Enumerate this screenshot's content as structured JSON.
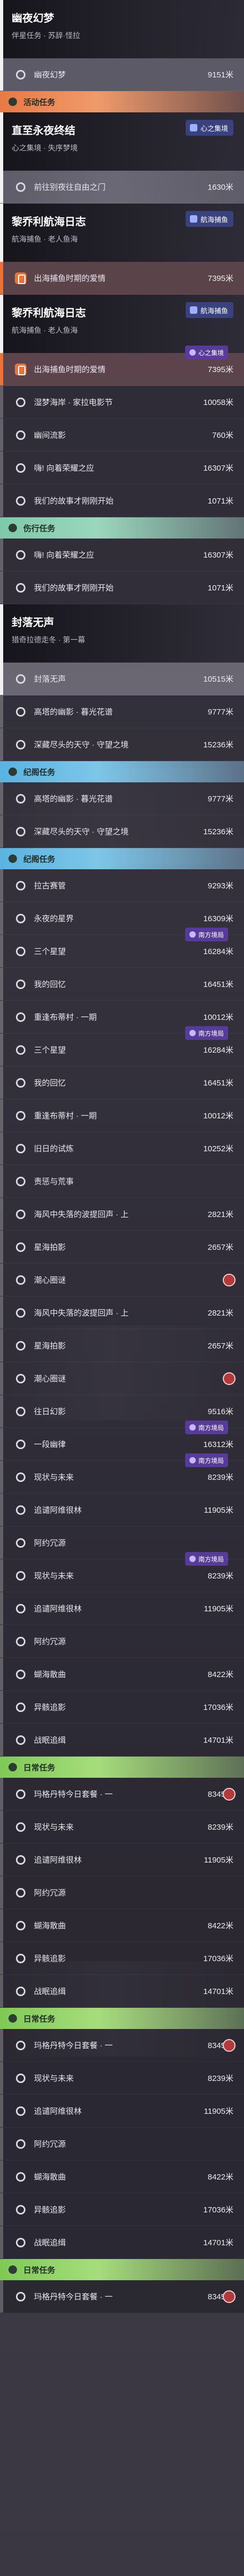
{
  "sections": [
    {
      "kind": "header",
      "title": "幽夜幻梦",
      "sub": "伴星任务 · 苏辞·怪拉",
      "badge": ""
    },
    {
      "kind": "item",
      "state": "sel",
      "name": "幽夜幻梦",
      "dist": "9151米"
    },
    {
      "kind": "sec",
      "color": "orange",
      "title": "活动任务"
    },
    {
      "kind": "header",
      "title": "直至永夜终结",
      "sub": "心之集境 · 失序梦境",
      "badge": "心之集境"
    },
    {
      "kind": "item",
      "state": "sel",
      "name": "前往别夜往自由之门",
      "dist": "1630米"
    },
    {
      "kind": "header",
      "title": "黎乔利航海日志",
      "sub": "航海捕鱼 · 老人鱼海",
      "badge": "航海捕鱼"
    },
    {
      "kind": "item",
      "state": "locked",
      "name": "出海捕鱼时期的爱情",
      "dist": "7395米"
    },
    {
      "kind": "header",
      "title": "黎乔利航海日志",
      "sub": "航海捕鱼 · 老人鱼海",
      "badge": "航海捕鱼"
    },
    {
      "kind": "item",
      "state": "locked",
      "name": "出海捕鱼时期的爱情",
      "dist": "7395米",
      "sidebadge": "心之集境"
    },
    {
      "kind": "item",
      "state": "",
      "name": "湿梦海岸 · 家拉电影节",
      "dist": "10058米"
    },
    {
      "kind": "item",
      "state": "",
      "name": "幽间流影",
      "dist": "760米"
    },
    {
      "kind": "item",
      "state": "",
      "name": "嗨! 向着荣耀之应",
      "dist": "16307米"
    },
    {
      "kind": "item",
      "state": "",
      "name": "我们的故事才刚刚开始",
      "dist": "1071米"
    },
    {
      "kind": "sec",
      "color": "teal",
      "title": "伤行任务"
    },
    {
      "kind": "item",
      "state": "",
      "name": "嗨! 向着荣耀之应",
      "dist": "16307米"
    },
    {
      "kind": "item",
      "state": "",
      "name": "我们的故事才刚刚开始",
      "dist": "1071米"
    },
    {
      "kind": "header",
      "title": "封落无声",
      "sub": "猎奇拉德走冬 · 第一幕",
      "badge": ""
    },
    {
      "kind": "item",
      "state": "sel",
      "name": "封落无声",
      "dist": "10515米"
    },
    {
      "kind": "item",
      "state": "",
      "name": "高塔的幽影 · 暮光花谱",
      "dist": "9777米"
    },
    {
      "kind": "item",
      "state": "",
      "name": "深藏尽头的天守 · 守望之境",
      "dist": "15236米"
    },
    {
      "kind": "sec",
      "color": "blue",
      "title": "纪阁任务"
    },
    {
      "kind": "item",
      "state": "",
      "name": "高塔的幽影 · 暮光花谱",
      "dist": "9777米"
    },
    {
      "kind": "item",
      "state": "",
      "name": "深藏尽头的天守 · 守望之境",
      "dist": "15236米"
    },
    {
      "kind": "sec",
      "color": "blue",
      "title": "纪阁任务"
    },
    {
      "kind": "item",
      "state": "",
      "name": "拉古赛管",
      "dist": "9293米"
    },
    {
      "kind": "item",
      "state": "",
      "name": "永夜的星界",
      "dist": "16309米"
    },
    {
      "kind": "item",
      "state": "",
      "name": "三个星望",
      "dist": "16284米",
      "sidebadge": "南方境局"
    },
    {
      "kind": "item",
      "state": "",
      "name": "我的回忆",
      "dist": "16451米"
    },
    {
      "kind": "item",
      "state": "",
      "name": "重逢布蒂村 · 一期",
      "dist": "10012米"
    },
    {
      "kind": "item",
      "state": "",
      "name": "三个星望",
      "dist": "16284米",
      "sidebadge": "南方境局"
    },
    {
      "kind": "item",
      "state": "",
      "name": "我的回忆",
      "dist": "16451米"
    },
    {
      "kind": "item",
      "state": "",
      "name": "重逢布蒂村 · 一期",
      "dist": "10012米"
    },
    {
      "kind": "item",
      "state": "",
      "name": "旧日的试炼",
      "dist": "10252米"
    },
    {
      "kind": "item",
      "state": "",
      "name": "责惩与荒事",
      "dist": ""
    },
    {
      "kind": "item",
      "state": "",
      "name": "海风中失落的波提回声 · 上",
      "dist": "2821米"
    },
    {
      "kind": "item",
      "state": "",
      "name": "星海拍影",
      "dist": "2657米"
    },
    {
      "kind": "item",
      "state": "",
      "name": "潮心圈谜",
      "dist": "",
      "marker": true
    },
    {
      "kind": "item",
      "state": "",
      "name": "海风中失落的波提回声 · 上",
      "dist": "2821米"
    },
    {
      "kind": "item",
      "state": "",
      "name": "星海拍影",
      "dist": "2657米"
    },
    {
      "kind": "item",
      "state": "",
      "name": "潮心圈谜",
      "dist": "",
      "marker": true
    },
    {
      "kind": "item",
      "state": "",
      "name": "往日幻影",
      "dist": "9516米"
    },
    {
      "kind": "item",
      "state": "",
      "name": "一段幽律",
      "dist": "16312米",
      "sidebadge": "南方境局"
    },
    {
      "kind": "item",
      "state": "",
      "name": "现状与未来",
      "dist": "8239米",
      "sidebadge": "南方境局"
    },
    {
      "kind": "item",
      "state": "",
      "name": "追谴阿维很林",
      "dist": "11905米"
    },
    {
      "kind": "item",
      "state": "",
      "name": "阿约冗源",
      "dist": ""
    },
    {
      "kind": "item",
      "state": "",
      "name": "现状与未来",
      "dist": "8239米",
      "sidebadge": "南方境局"
    },
    {
      "kind": "item",
      "state": "",
      "name": "追谴阿维很林",
      "dist": "11905米"
    },
    {
      "kind": "item",
      "state": "",
      "name": "阿约冗源",
      "dist": ""
    },
    {
      "kind": "item",
      "state": "",
      "name": "蝴海散曲",
      "dist": "8422米"
    },
    {
      "kind": "item",
      "state": "",
      "name": "异骸追影",
      "dist": "17036米"
    },
    {
      "kind": "item",
      "state": "",
      "name": "战眠追缉",
      "dist": "14701米"
    },
    {
      "kind": "sec",
      "color": "green2",
      "title": "日常任务"
    },
    {
      "kind": "item",
      "state": "",
      "name": "玛格丹特今日套餐 · 一",
      "dist": "8345米",
      "marker": true
    },
    {
      "kind": "item",
      "state": "",
      "name": "现状与未来",
      "dist": "8239米"
    },
    {
      "kind": "item",
      "state": "",
      "name": "追谴阿维很林",
      "dist": "11905米"
    },
    {
      "kind": "item",
      "state": "",
      "name": "阿约冗源",
      "dist": ""
    },
    {
      "kind": "item",
      "state": "",
      "name": "蝴海散曲",
      "dist": "8422米"
    },
    {
      "kind": "item",
      "state": "",
      "name": "异骸追影",
      "dist": "17036米"
    },
    {
      "kind": "item",
      "state": "",
      "name": "战眠追缉",
      "dist": "14701米"
    },
    {
      "kind": "sec",
      "color": "green2",
      "title": "日常任务"
    },
    {
      "kind": "item",
      "state": "",
      "name": "玛格丹特今日套餐 · 一",
      "dist": "8345米",
      "marker": true
    },
    {
      "kind": "item",
      "state": "",
      "name": "现状与未来",
      "dist": "8239米"
    },
    {
      "kind": "item",
      "state": "",
      "name": "追谴阿维很林",
      "dist": "11905米"
    },
    {
      "kind": "item",
      "state": "",
      "name": "阿约冗源",
      "dist": ""
    },
    {
      "kind": "item",
      "state": "",
      "name": "蝴海散曲",
      "dist": "8422米"
    },
    {
      "kind": "item",
      "state": "",
      "name": "异骸追影",
      "dist": "17036米"
    },
    {
      "kind": "item",
      "state": "",
      "name": "战眠追缉",
      "dist": "14701米"
    },
    {
      "kind": "sec",
      "color": "green2",
      "title": "日常任务"
    },
    {
      "kind": "item",
      "state": "",
      "name": "玛格丹特今日套餐 · 一",
      "dist": "8345米",
      "marker": true
    }
  ]
}
